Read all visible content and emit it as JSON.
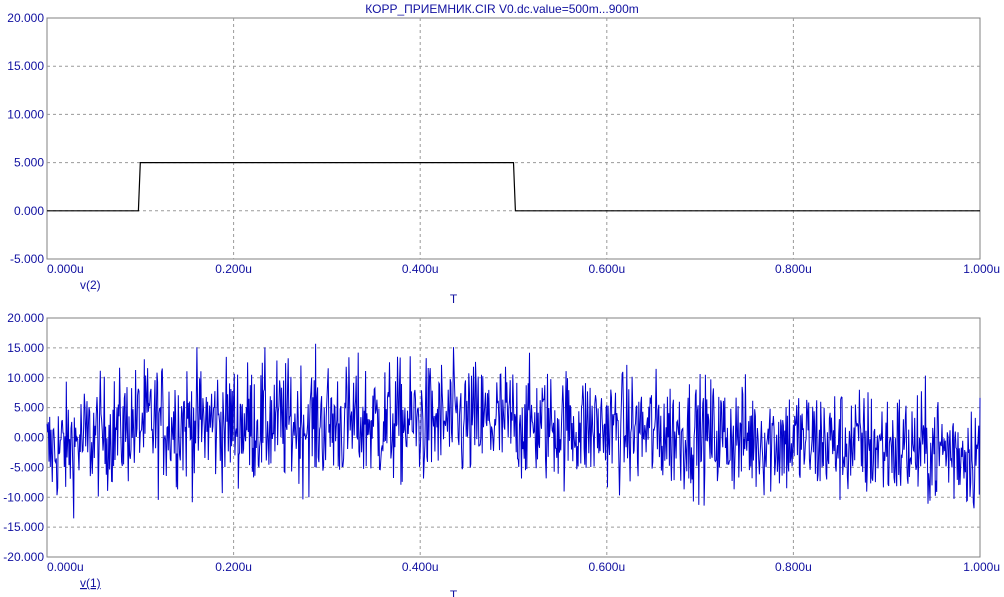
{
  "title": "КОРР_ПРИЕМНИК.CIR V0.dc.value=500m...900m",
  "colors": {
    "ink": "#1010a0",
    "trace_top": "#000000",
    "trace_bottom": "#0000cc",
    "grid": "#9a9a9a"
  },
  "chart_data": [
    {
      "type": "line",
      "ylim": [
        -5,
        20
      ],
      "xlim": [
        0,
        1.0
      ],
      "y_ticks": [
        "-5.000",
        "0.000",
        "5.000",
        "10.000",
        "15.000",
        "20.000"
      ],
      "x_ticks": [
        "0.000u",
        "0.200u",
        "0.400u",
        "0.600u",
        "0.800u",
        "1.000u"
      ],
      "xlabel": "T",
      "grid": true,
      "series": [
        {
          "name": "v(2)",
          "x": [
            0,
            0.098,
            0.1,
            0.5,
            0.502,
            1.0
          ],
          "y": [
            0,
            0,
            5,
            5,
            0,
            0
          ]
        }
      ]
    },
    {
      "type": "line",
      "ylim": [
        -20,
        20
      ],
      "xlim": [
        0,
        1.0
      ],
      "y_ticks": [
        "-20.000",
        "-15.000",
        "-10.000",
        "-5.000",
        "0.000",
        "5.000",
        "10.000",
        "15.000",
        "20.000"
      ],
      "x_ticks": [
        "0.000u",
        "0.200u",
        "0.400u",
        "0.600u",
        "0.800u",
        "1.000u"
      ],
      "xlabel": "T",
      "grid": true,
      "series": [
        {
          "name": "v(1)",
          "x": [
            0,
            0.1,
            0.5,
            1.0
          ],
          "y": [
            -2.5,
            2.5,
            2.5,
            -2.5
          ]
        }
      ]
    }
  ]
}
